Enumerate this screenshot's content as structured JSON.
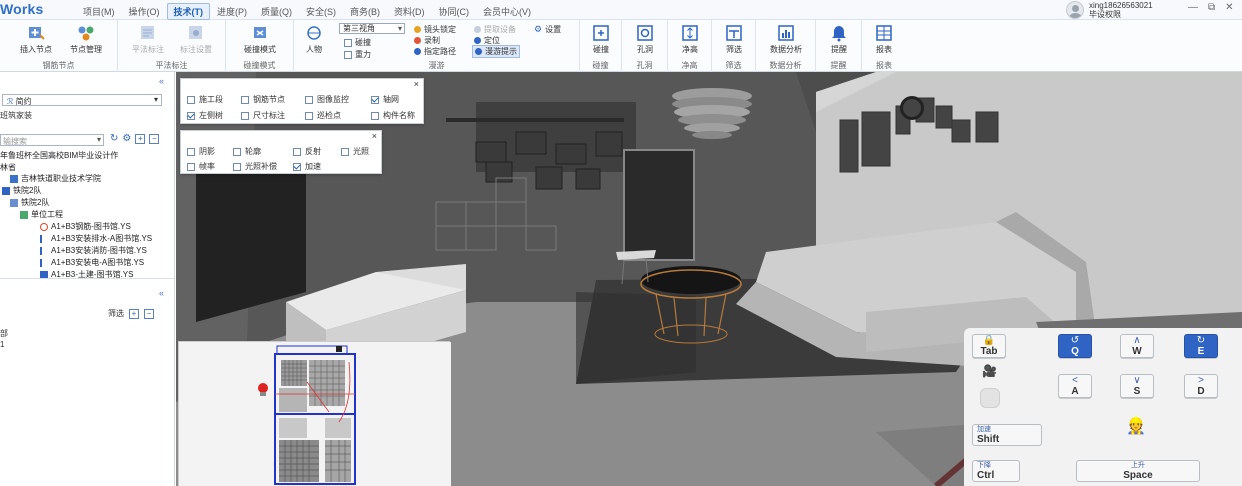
{
  "app": {
    "logo": "Works"
  },
  "menu": [
    {
      "label": "项目(M)"
    },
    {
      "label": "操作(O)"
    },
    {
      "label": "技术(T)",
      "active": true
    },
    {
      "label": "进度(P)"
    },
    {
      "label": "质量(Q)"
    },
    {
      "label": "安全(S)"
    },
    {
      "label": "商务(B)"
    },
    {
      "label": "资料(D)"
    },
    {
      "label": "协同(C)"
    },
    {
      "label": "会员中心(V)"
    }
  ],
  "user": {
    "name": "xing18626563021",
    "role": "毕设权限"
  },
  "window_buttons": {
    "minimize": "—",
    "restore": "⧉",
    "close": "✕"
  },
  "ribbon": {
    "insert_node": "插入节点",
    "node_manage": "节点管理",
    "group_rebar": "钢筋节点",
    "plan_mark": "平法标注",
    "mark_settings": "标注设置",
    "group_plan": "平法标注",
    "collision_mode": "碰撞模式",
    "group_collision": "碰撞模式",
    "person": "人物",
    "view_select": "第三视角",
    "collision": "碰撞",
    "gravity": "重力",
    "lock_camera": "镜头锁定",
    "record": "录制",
    "set_path": "指定路径",
    "lift_device": "提取设备",
    "locate": "定位",
    "tour_hint": "漫游提示",
    "settings": "设置",
    "group_tour": "漫游",
    "groups": [
      {
        "btn": "碰撞",
        "label": "碰撞"
      },
      {
        "btn": "孔洞",
        "label": "孔洞"
      },
      {
        "btn": "净高",
        "label": "净高"
      },
      {
        "btn": "筛选",
        "label": "筛选"
      },
      {
        "btn": "数据分析",
        "label": "数据分析"
      },
      {
        "btn": "提醒",
        "label": "提醒"
      },
      {
        "btn": "报表",
        "label": "报表"
      }
    ]
  },
  "left": {
    "collapse": "«",
    "profile": "简约",
    "project": "班筑家装",
    "search_placeholder": "输搜索",
    "tree": [
      {
        "label": "年鲁班杯全国高校BIM毕业设计作"
      },
      {
        "label": "林省"
      },
      {
        "label": "吉林铁道职业技术学院"
      },
      {
        "label": "铁院2队"
      },
      {
        "label": "铁院2队"
      },
      {
        "label": "单位工程"
      },
      {
        "label": "A1+B3钢筋-图书馆.YS"
      },
      {
        "label": "A1+B3安装排水-A图书馆.YS"
      },
      {
        "label": "A1+B3安装消防-图书馆.YS"
      },
      {
        "label": "A1+B3安装电-A图书馆.YS"
      },
      {
        "label": "A1+B3-土建-图书馆.YS"
      }
    ],
    "filter": "筛选",
    "list": [
      {
        "label": "部"
      },
      {
        "label": "1"
      }
    ]
  },
  "panel1": {
    "close": "×",
    "items": [
      {
        "label": "施工段",
        "checked": false
      },
      {
        "label": "钢筋节点",
        "checked": false
      },
      {
        "label": "图像监控",
        "checked": false
      },
      {
        "label": "轴网",
        "checked": true
      },
      {
        "label": "左侧树",
        "checked": true
      },
      {
        "label": "尺寸标注",
        "checked": false
      },
      {
        "label": "巡检点",
        "checked": false
      },
      {
        "label": "构件名称",
        "checked": false
      }
    ]
  },
  "panel2": {
    "close": "×",
    "items": [
      {
        "label": "阴影",
        "checked": false
      },
      {
        "label": "轮廓",
        "checked": false
      },
      {
        "label": "反射",
        "checked": false
      },
      {
        "label": "光照",
        "checked": false
      },
      {
        "label": "帧率",
        "checked": false
      },
      {
        "label": "光照补偿",
        "checked": false
      },
      {
        "label": "加速",
        "checked": true
      }
    ]
  },
  "keys": {
    "tab": "Tab",
    "q": "Q",
    "w": "W",
    "e": "E",
    "a": "A",
    "s": "S",
    "d": "D",
    "shift_top": "加速",
    "shift": "Shift",
    "ctrl_top": "下降",
    "ctrl": "Ctrl",
    "space_top": "上升",
    "space": "Space"
  },
  "colors": {
    "accent": "#2f64c4",
    "ribbon_bg": "#fbfcfe",
    "viewport_floor": "#8a8a8a"
  }
}
